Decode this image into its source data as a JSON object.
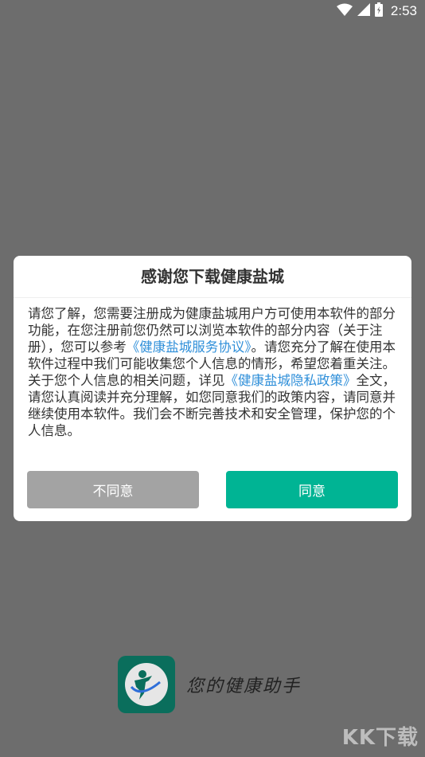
{
  "status_bar": {
    "time": "2:53"
  },
  "dialog": {
    "title": "感谢您下载健康盐城",
    "p1_before": "请您了解，您需要注册成为健康盐城用户方可使用本软件的部分功能，在您注册前您仍然可以浏览本软件的部分内容（关于注册），您可以参考",
    "p1_link": "《健康盐城服务协议》",
    "p1_after": "。请您充分了解在使用本软件过程中我们可能收集您个人信息的情形，希望您着重关注。",
    "p2_before": "关于您个人信息的相关问题，详见",
    "p2_link": "《健康盐城隐私政策》",
    "p2_after": "全文，请您认真阅读并充分理解，如您同意我们的政策内容，请同意并继续使用本软件。我们会不断完善技术和安全管理，保护您的个人信息。",
    "disagree_label": "不同意",
    "agree_label": "同意"
  },
  "brand": {
    "slogan": "您的健康助手"
  },
  "watermark": "KK下载",
  "colors": {
    "agree": "#00b494",
    "disagree": "#a3a3a3",
    "link": "#2f8fd9",
    "logo": "#0a6e5c"
  }
}
